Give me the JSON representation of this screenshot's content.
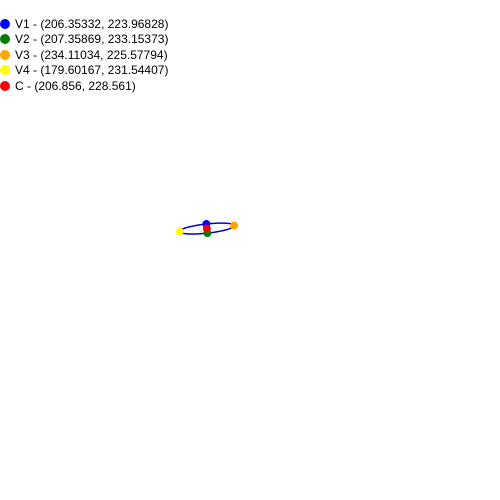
{
  "points": [
    {
      "label": "V1 - (206.35332, 223.96828)",
      "color": "#0000ff",
      "x": 206.35332,
      "y": 223.96828
    },
    {
      "label": "V2 - (207.35869, 233.15373)",
      "color": "#008000",
      "x": 207.35869,
      "y": 233.15373
    },
    {
      "label": "V3 - (234.11034, 225.57794)",
      "color": "#ffa500",
      "x": 234.11034,
      "y": 225.57794
    },
    {
      "label": "V4 - (179.60167, 231.54407)",
      "color": "#ffff00",
      "x": 179.60167,
      "y": 231.54407
    },
    {
      "label": "C - (206.856, 228.561)",
      "color": "#ff0000",
      "x": 206.856,
      "y": 228.561
    }
  ],
  "ellipse_color": "#0000cd"
}
